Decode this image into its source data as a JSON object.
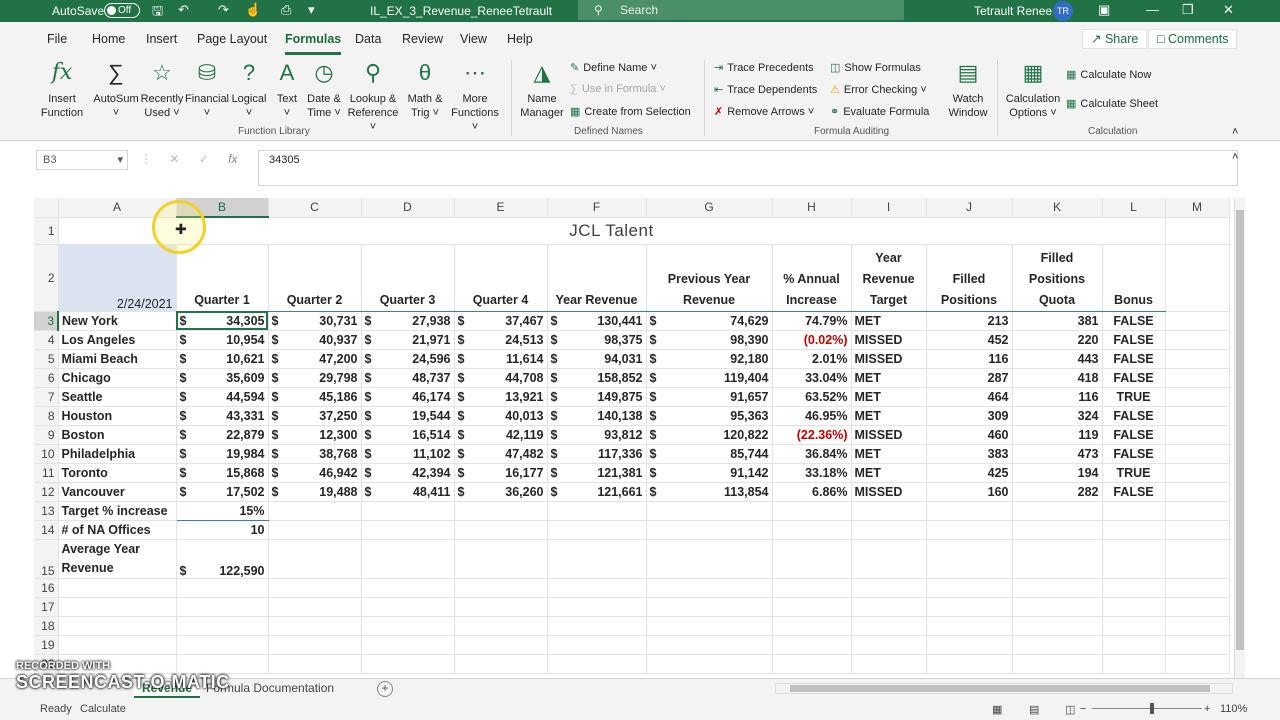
{
  "titlebar": {
    "autosave_label": "AutoSave",
    "autosave_state": "Off",
    "filename": "IL_EX_3_Revenue_ReneeTetrault",
    "search_placeholder": "Search",
    "user_name": "Tetrault Renee",
    "user_initials": "TR"
  },
  "menu": {
    "tabs": [
      "File",
      "Home",
      "Insert",
      "Page Layout",
      "Formulas",
      "Data",
      "Review",
      "View",
      "Help"
    ],
    "share_label": "Share",
    "comments_label": "Comments"
  },
  "ribbon": {
    "insert_function": [
      "Insert",
      "Function"
    ],
    "autosum": "AutoSum",
    "recently_used": [
      "Recently",
      "Used"
    ],
    "financial": "Financial",
    "logical": "Logical",
    "text": "Text",
    "date_time": [
      "Date &",
      "Time"
    ],
    "lookup_reference": [
      "Lookup &",
      "Reference"
    ],
    "math_trig": [
      "Math &",
      "Trig"
    ],
    "more_functions": [
      "More",
      "Functions"
    ],
    "group_function_library": "Function Library",
    "name_manager": [
      "Name",
      "Manager"
    ],
    "define_name": "Define Name",
    "use_in_formula": "Use in Formula",
    "create_from_selection": "Create from Selection",
    "group_defined_names": "Defined Names",
    "trace_precedents": "Trace Precedents",
    "trace_dependents": "Trace Dependents",
    "remove_arrows": "Remove Arrows",
    "show_formulas": "Show Formulas",
    "error_checking": "Error Checking",
    "evaluate_formula": "Evaluate Formula",
    "watch_window": [
      "Watch",
      "Window"
    ],
    "group_formula_auditing": "Formula Auditing",
    "calculation_options": [
      "Calculation",
      "Options"
    ],
    "calculate_now": "Calculate Now",
    "calculate_sheet": "Calculate Sheet",
    "group_calculation": "Calculation"
  },
  "formula_bar": {
    "name_box": "B3",
    "formula": "34305"
  },
  "sheet": {
    "column_headers": [
      "A",
      "B",
      "C",
      "D",
      "E",
      "F",
      "G",
      "H",
      "I",
      "J",
      "K",
      "L",
      "M"
    ],
    "title": "JCL Talent",
    "date": "2/24/2021",
    "headers": [
      "Quarter 1",
      "Quarter 2",
      "Quarter 3",
      "Quarter 4",
      "Year Revenue",
      "Previous Year Revenue",
      "% Annual Increase",
      "Year Revenue Target",
      "Filled Positions",
      "Filled Positions Quota",
      "Bonus"
    ],
    "currency_symbol": "$",
    "rows": [
      {
        "city": "New York",
        "q1": "34,305",
        "q2": "30,731",
        "q3": "27,938",
        "q4": "37,467",
        "year": "130,441",
        "prev": "74,629",
        "pct": "74.79%",
        "target": "MET",
        "filled": "213",
        "quota": "381",
        "bonus": "FALSE"
      },
      {
        "city": "Los Angeles",
        "q1": "10,954",
        "q2": "40,937",
        "q3": "21,971",
        "q4": "24,513",
        "year": "98,375",
        "prev": "98,390",
        "pct": "(0.02%)",
        "target": "MISSED",
        "filled": "452",
        "quota": "220",
        "bonus": "FALSE"
      },
      {
        "city": "Miami Beach",
        "q1": "10,621",
        "q2": "47,200",
        "q3": "24,596",
        "q4": "11,614",
        "year": "94,031",
        "prev": "92,180",
        "pct": "2.01%",
        "target": "MISSED",
        "filled": "116",
        "quota": "443",
        "bonus": "FALSE"
      },
      {
        "city": "Chicago",
        "q1": "35,609",
        "q2": "29,798",
        "q3": "48,737",
        "q4": "44,708",
        "year": "158,852",
        "prev": "119,404",
        "pct": "33.04%",
        "target": "MET",
        "filled": "287",
        "quota": "418",
        "bonus": "FALSE"
      },
      {
        "city": "Seattle",
        "q1": "44,594",
        "q2": "45,186",
        "q3": "46,174",
        "q4": "13,921",
        "year": "149,875",
        "prev": "91,657",
        "pct": "63.52%",
        "target": "MET",
        "filled": "464",
        "quota": "116",
        "bonus": "TRUE"
      },
      {
        "city": "Houston",
        "q1": "43,331",
        "q2": "37,250",
        "q3": "19,544",
        "q4": "40,013",
        "year": "140,138",
        "prev": "95,363",
        "pct": "46.95%",
        "target": "MET",
        "filled": "309",
        "quota": "324",
        "bonus": "FALSE"
      },
      {
        "city": "Boston",
        "q1": "22,879",
        "q2": "12,300",
        "q3": "16,514",
        "q4": "42,119",
        "year": "93,812",
        "prev": "120,822",
        "pct": "(22.36%)",
        "target": "MISSED",
        "filled": "460",
        "quota": "119",
        "bonus": "FALSE"
      },
      {
        "city": "Philadelphia",
        "q1": "19,984",
        "q2": "38,768",
        "q3": "11,102",
        "q4": "47,482",
        "year": "117,336",
        "prev": "85,744",
        "pct": "36.84%",
        "target": "MET",
        "filled": "383",
        "quota": "473",
        "bonus": "FALSE"
      },
      {
        "city": "Toronto",
        "q1": "15,868",
        "q2": "46,942",
        "q3": "42,394",
        "q4": "16,177",
        "year": "121,381",
        "prev": "91,142",
        "pct": "33.18%",
        "target": "MET",
        "filled": "425",
        "quota": "194",
        "bonus": "TRUE"
      },
      {
        "city": "Vancouver",
        "q1": "17,502",
        "q2": "19,488",
        "q3": "48,411",
        "q4": "36,260",
        "year": "121,661",
        "prev": "113,854",
        "pct": "6.86%",
        "target": "MISSED",
        "filled": "160",
        "quota": "282",
        "bonus": "FALSE"
      }
    ],
    "target_label": "Target % increase",
    "target_value": "15%",
    "offices_label": "# of NA Offices",
    "offices_value": "10",
    "avg_label_1": "Average Year",
    "avg_label_2": "Revenue",
    "avg_value": "122,590"
  },
  "sheet_tabs": {
    "tab1": "Revenue",
    "tab2": "Formula Documentation"
  },
  "status": {
    "ready": "Ready",
    "calculate": "Calculate",
    "zoom": "110%"
  },
  "watermark": {
    "line1": "RECORDED WITH",
    "line2": "SCREENCAST-O-MATIC"
  }
}
